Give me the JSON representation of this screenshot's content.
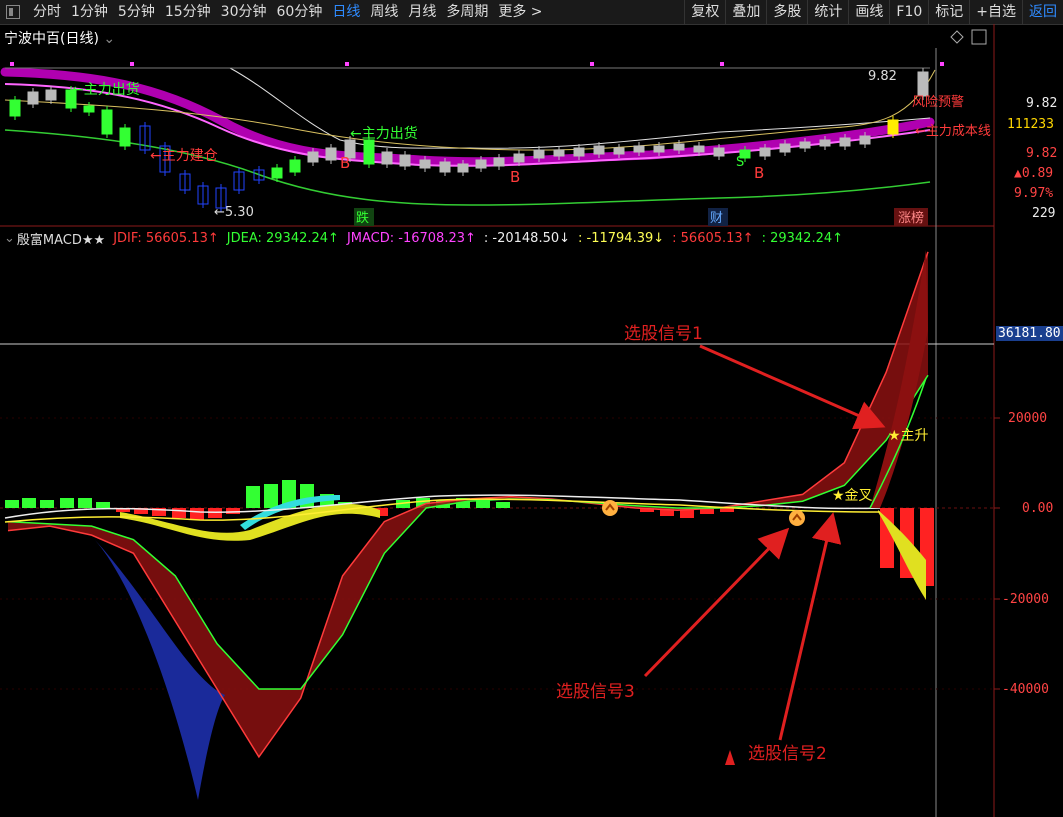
{
  "toolbar": {
    "tabs": [
      "分时",
      "1分钟",
      "5分钟",
      "15分钟",
      "30分钟",
      "60分钟",
      "日线",
      "周线",
      "月线",
      "多周期",
      "更多 >"
    ],
    "active_tab": "日线",
    "right_buttons": [
      "复权",
      "叠加",
      "多股",
      "统计",
      "画线",
      "F10",
      "标记",
      "+自选",
      "返回"
    ]
  },
  "upper_panel": {
    "title": "宁波中百(日线)",
    "max_price": "9.82",
    "min_price": "5.30",
    "axis_values": [
      "9.82",
      "111233",
      "9.82",
      "▲0.89",
      "9.97%",
      "229"
    ],
    "annotations": [
      "主力出货",
      "主力建仓",
      "主力出货",
      "风险预警",
      "主力成本线"
    ],
    "signals": [
      "B",
      "B",
      "B",
      "S"
    ],
    "bottom_tags": [
      "跌",
      "财",
      "涨榜"
    ]
  },
  "indicator_bar": {
    "name": "殷富MACD★★",
    "jdif": "JDIF: 56605.13↑",
    "jdea": "JDEA: 29342.24↑",
    "jmacd": "JMACD: -16708.23↑",
    "v1": ": -20148.50↓",
    "v2": ": -11794.39↓",
    "v3": ": 56605.13↑",
    "v4": ": 29342.24↑"
  },
  "lower_panel": {
    "crosshair_value": "36181.80",
    "y_ticks": [
      "20000",
      "0.00",
      "-20000",
      "-40000"
    ],
    "marks": [
      "★主升",
      "★金叉"
    ],
    "callouts": [
      "选股信号1",
      "选股信号3",
      "选股信号2"
    ]
  },
  "colors": {
    "jdif": "#ff3b3b",
    "jdea": "#33ff33",
    "jmacd": "#ff44ff",
    "accent_blue": "#2f8bff",
    "callout_red": "#e02020"
  },
  "chart_data": {
    "type": "line",
    "title": "",
    "xlabel": "",
    "ylabel": "",
    "ylim": [
      -65000,
      60000
    ],
    "series": [
      {
        "name": "JDIF",
        "values": [
          -5000,
          -4000,
          -6000,
          -10000,
          -25000,
          -40000,
          -55000,
          -42000,
          -15000,
          -3000,
          1000,
          2000,
          2500,
          2000,
          1000,
          0,
          -500,
          0,
          1500,
          3000,
          10000,
          30000,
          56605
        ]
      },
      {
        "name": "JDEA",
        "values": [
          -3000,
          -3500,
          -4000,
          -7000,
          -15000,
          -30000,
          -40000,
          -40000,
          -28000,
          -10000,
          0,
          1500,
          2000,
          1800,
          1200,
          500,
          0,
          0,
          500,
          1500,
          5000,
          15000,
          29342
        ]
      }
    ]
  }
}
